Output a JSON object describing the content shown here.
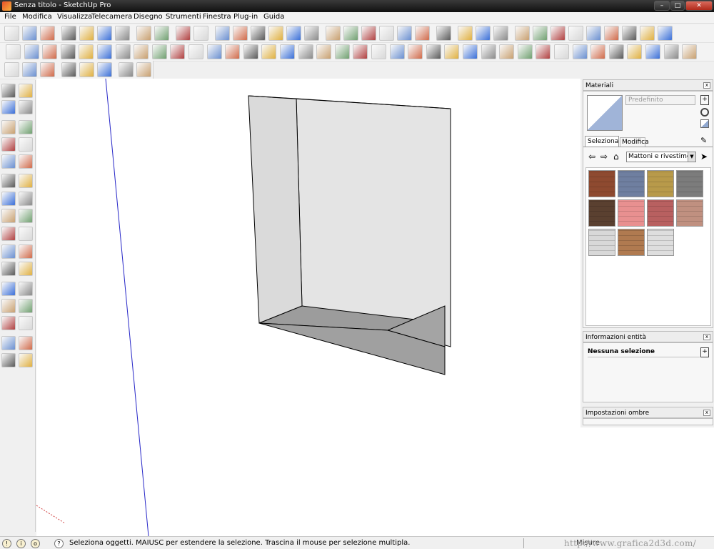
{
  "window": {
    "title": "Senza titolo - SketchUp Pro"
  },
  "menu": [
    "File",
    "Modifica",
    "Visualizza",
    "Telecamera",
    "Disegno",
    "Strumenti",
    "Finestra",
    "Plug-in",
    "Guida"
  ],
  "toolbars": {
    "row1": [
      "new-icon",
      "open-icon",
      "save-icon",
      "cut-icon",
      "copy-icon",
      "paste-icon",
      "erase-icon",
      "undo-icon",
      "redo-icon",
      "print-icon",
      "model-info-icon",
      "iso-view-icon",
      "top-view-icon",
      "front-view-icon",
      "right-view-icon",
      "back-view-icon",
      "left-view-icon",
      "xray-icon",
      "back-edges-icon",
      "wireframe-icon",
      "hidden-line-icon",
      "shaded-icon",
      "textured-icon",
      "monochrome-icon",
      "section-plane-icon",
      "display-section-icon",
      "display-cuts-icon",
      "3d-warehouse-icon",
      "share-model-icon",
      "get-models-icon",
      "share-component-icon",
      "sun-icon",
      "shadows-icon",
      "fog-icon",
      "photo-match-icon",
      "sandbox-icon"
    ],
    "row2_count": 38,
    "row3": [
      "component-icon",
      "group-icon",
      "solid-icon",
      "axis-j-icon",
      "axis-v-icon",
      "axis-n-icon",
      "push-icon",
      "pull-icon"
    ]
  },
  "left_tools": [
    "select-icon",
    "make-component-icon",
    "paint-bucket-icon",
    "eraser-icon",
    "rectangle-icon",
    "line-icon",
    "circle-icon",
    "arc-icon",
    "polygon-icon",
    "freehand-icon",
    "move-icon",
    "push-pull-icon",
    "rotate-icon",
    "follow-me-icon",
    "scale-icon",
    "offset-icon",
    "tape-measure-icon",
    "dimension-icon",
    "protractor-icon",
    "text-icon",
    "axes-icon",
    "3d-text-icon",
    "orbit-icon",
    "pan-icon",
    "zoom-icon",
    "zoom-window-icon",
    "zoom-extents-icon",
    "previous-view-icon",
    "position-camera-icon",
    "look-around-icon",
    "walk-icon",
    "section-icon"
  ],
  "materials_panel": {
    "title": "Materiali",
    "default_name": "Predefinito",
    "tabs": [
      "Seleziona",
      "Modifica"
    ],
    "library": "Mattoni e rivestimenti",
    "swatches": [
      {
        "name": "brick-red",
        "color": "#8e4a30"
      },
      {
        "name": "stone-blue",
        "color": "#6f7fa0"
      },
      {
        "name": "stone-yellow",
        "color": "#b89a4a"
      },
      {
        "name": "block-gray",
        "color": "#7c7c7c"
      },
      {
        "name": "brick-dark",
        "color": "#5a4030"
      },
      {
        "name": "tile-pink",
        "color": "#e89090"
      },
      {
        "name": "brick-rose",
        "color": "#b86060"
      },
      {
        "name": "tile-salmon",
        "color": "#c09080"
      },
      {
        "name": "siding-light",
        "color": "#d8d8d8"
      },
      {
        "name": "wood-brown",
        "color": "#b07a50"
      },
      {
        "name": "stucco-white",
        "color": "#dedede"
      }
    ]
  },
  "entity_panel": {
    "title": "Informazioni entità",
    "value": "Nessuna selezione"
  },
  "shadows_panel": {
    "title": "Impostazioni ombre"
  },
  "status": {
    "message": "Seleziona oggetti. MAIUSC per estendere la selezione. Trascina il mouse per selezione multipla.",
    "measure_label": "Misure",
    "watermark": "http://www.grafica2d3d.com/"
  },
  "colors": {
    "accent": "#3a6fd8",
    "face_light": "#e6e6e6",
    "face_dark": "#a8a8a8",
    "floor": "#999999"
  }
}
